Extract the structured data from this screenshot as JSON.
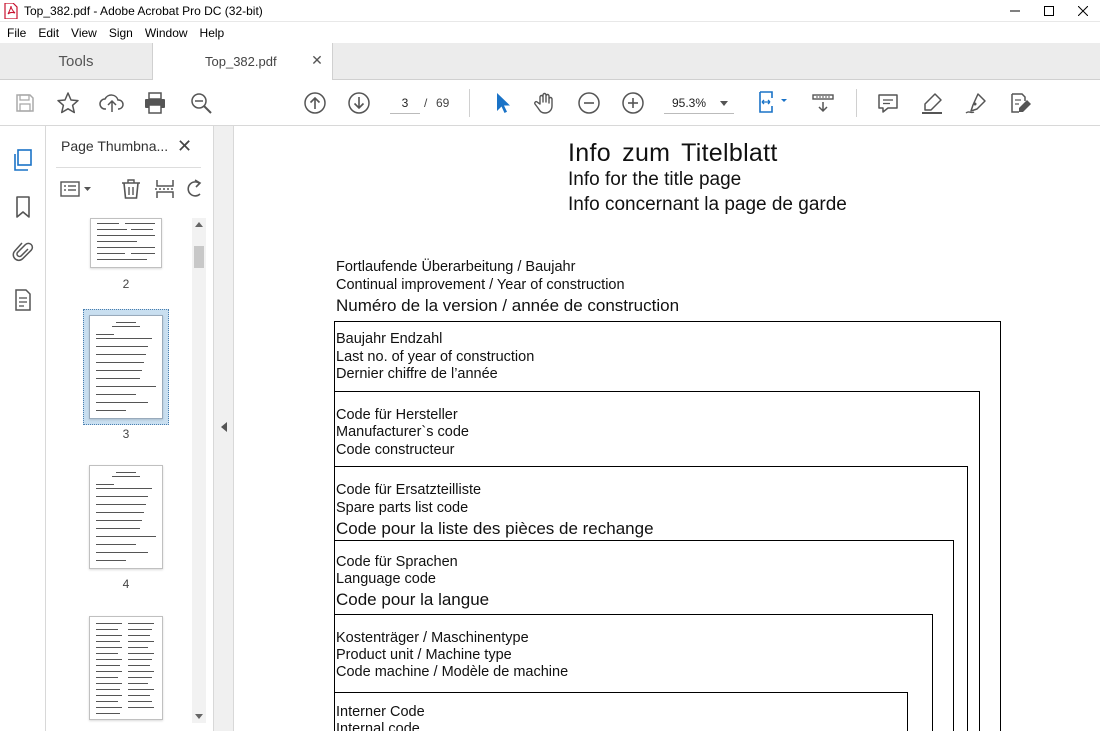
{
  "window": {
    "title": "Top_382.pdf - Adobe Acrobat Pro DC (32-bit)"
  },
  "menu": [
    "File",
    "Edit",
    "View",
    "Sign",
    "Window",
    "Help"
  ],
  "tabs": {
    "tools": "Tools",
    "document": "Top_382.pdf"
  },
  "toolbar": {
    "current_page": "3",
    "page_separator": "/",
    "total_pages": "69",
    "zoom": "95.3%"
  },
  "thumbnails": {
    "header": "Page Thumbna...",
    "pages": [
      {
        "label": "2"
      },
      {
        "label": "3",
        "selected": true
      },
      {
        "label": "4"
      },
      {
        "label": ""
      }
    ]
  },
  "document": {
    "title_de": "Info  zum  Titelblatt",
    "title_en": "Info for the title page",
    "title_fr": "Info concernant la page de garde",
    "sections": [
      {
        "de": "Fortlaufende Überarbeitung / Baujahr",
        "en": "Continual improvement / Year of construction",
        "fr": "Numéro de la version / année de construction"
      },
      {
        "de": "Baujahr Endzahl",
        "en": "Last no. of year of construction",
        "fr": "Dernier chiffre de l’année"
      },
      {
        "de": "Code für Hersteller",
        "en": "Manufacturer`s  code",
        "fr": "Code constructeur"
      },
      {
        "de": "Code für Ersatzteilliste",
        "en": "Spare parts list code",
        "fr": "Code pour la liste des pièces de rechange"
      },
      {
        "de": "Code für Sprachen",
        "en": "Language code",
        "fr": "Code pour la langue"
      },
      {
        "de": "Kostenträger / Maschinentype",
        "en": "Product unit / Machine type",
        "fr": "Code machine / Modèle de machine"
      },
      {
        "de": "Interner Code",
        "en": "Internal code",
        "fr": ""
      }
    ]
  },
  "colors": {
    "accent": "#1a73c7",
    "selection": "#c9dff0",
    "tab_bar": "#ececec"
  }
}
